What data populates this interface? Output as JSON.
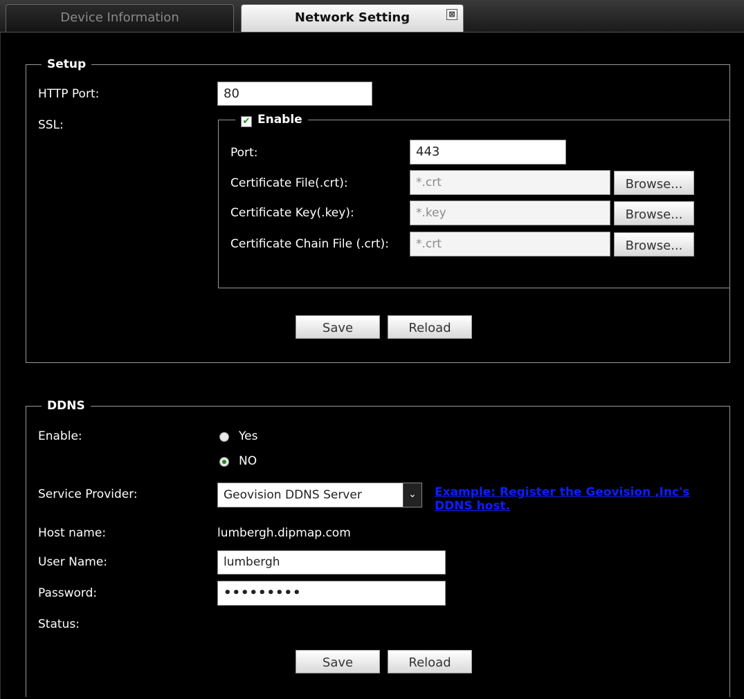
{
  "tabs": [
    {
      "label": "Device Information",
      "active": false
    },
    {
      "label": "Network Setting",
      "active": true
    }
  ],
  "tab_close_glyph": "⊠",
  "setup": {
    "legend": "Setup",
    "http_port_label": "HTTP Port:",
    "http_port_value": "80",
    "ssl_label": "SSL:",
    "ssl_enable_label": "Enable",
    "ssl_enable_checked": true,
    "ssl_port_label": "Port:",
    "ssl_port_value": "443",
    "cert_file_label": "Certificate File(.crt):",
    "cert_file_placeholder": "*.crt",
    "cert_key_label": "Certificate Key(.key):",
    "cert_key_placeholder": "*.key",
    "cert_chain_label": "Certificate Chain File (.crt):",
    "cert_chain_placeholder": "*.crt",
    "browse_label": "Browse...",
    "save_label": "Save",
    "reload_label": "Reload"
  },
  "ddns": {
    "legend": "DDNS",
    "enable_label": "Enable:",
    "yes_label": "Yes",
    "no_label": "NO",
    "selected": "NO",
    "service_provider_label": "Service Provider:",
    "service_provider_value": "Geovision DDNS Server",
    "example_link": "Example: Register the Geovision ,Inc's DDNS host.",
    "host_name_label": "Host name:",
    "host_name_value": "lumbergh.dipmap.com",
    "user_name_label": "User Name:",
    "user_name_value": "lumbergh",
    "password_label": "Password:",
    "password_value": "•••••••••",
    "status_label": "Status:",
    "save_label": "Save",
    "reload_label": "Reload"
  },
  "colors": {
    "background": "#000000",
    "link": "#0b1fff",
    "check": "#1a8a1a"
  }
}
